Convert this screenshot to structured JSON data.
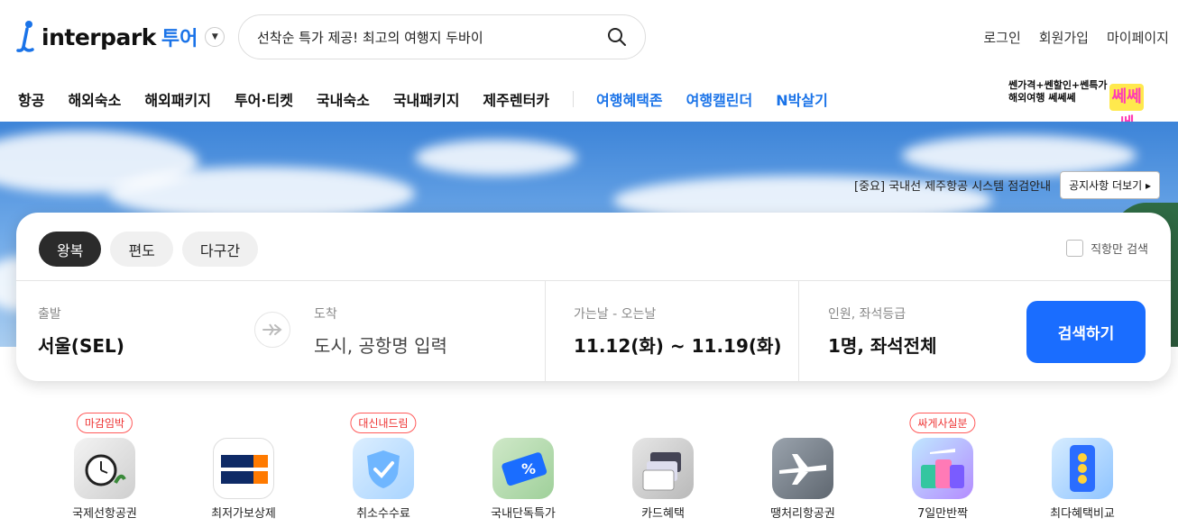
{
  "header": {
    "logo_text": "interpark",
    "logo_sub": "투어",
    "search_placeholder": "선착순 특가 제공! 최고의 여행지 두바이",
    "util": [
      "로그인",
      "회원가입",
      "마이페이지"
    ]
  },
  "gnb": {
    "items": [
      "항공",
      "해외숙소",
      "해외패키지",
      "투어·티켓",
      "국내숙소",
      "국내패키지",
      "제주렌터카"
    ],
    "highlight": [
      "여행혜택존",
      "여행캘린더",
      "N박살기"
    ]
  },
  "promo": {
    "line1": "쎈가격+쎈할인+쎈특가",
    "line2": "해외여행 쎄쎄쎄",
    "badge": "쎄쎄쎄"
  },
  "notice": {
    "text": "[중요] 국내선 제주항공 시스템 점검안내",
    "button": "공지사항 더보기 ▸"
  },
  "booking": {
    "tabs": [
      "왕복",
      "편도",
      "다구간"
    ],
    "active_tab": "왕복",
    "direct_only": "직항만 검색",
    "from_label": "출발",
    "from_value": "서울(SEL)",
    "to_label": "도착",
    "to_placeholder": "도시, 공항명 입력",
    "date_label": "가는날 - 오는날",
    "date_value": "11.12(화) ~ 11.19(화)",
    "pax_label": "인원, 좌석등급",
    "pax_value": "1명, 좌석전체",
    "search_button": "검색하기"
  },
  "quick_menu": [
    {
      "label": "국제선항공권",
      "badge": "마감임박"
    },
    {
      "label": "최저가보상제",
      "badge": ""
    },
    {
      "label": "취소수수료",
      "badge": "대신내드림"
    },
    {
      "label": "국내단독특가",
      "badge": ""
    },
    {
      "label": "카드혜택",
      "badge": ""
    },
    {
      "label": "땡처리항공권",
      "badge": ""
    },
    {
      "label": "7일만반짝",
      "badge": "싸게사실분"
    },
    {
      "label": "최다혜택비교",
      "badge": ""
    }
  ],
  "colors": {
    "brand_blue": "#1a6dff",
    "badge_red": "#e33333",
    "active_tab": "#2b2b2b"
  }
}
